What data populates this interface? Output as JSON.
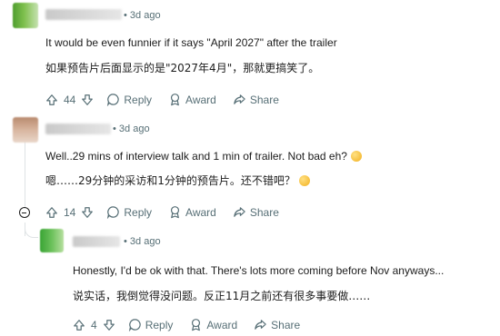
{
  "comments": [
    {
      "age": "3d ago",
      "text_en": "It would be even funnier if it says \"April 2027\" after the trailer",
      "text_zh": "如果预告片后面显示的是\"2027年4月\"，那就更搞笑了。",
      "votes": "44",
      "reply": "Reply",
      "award": "Award",
      "share": "Share"
    },
    {
      "age": "3d ago",
      "text_en": "Well..29 mins of interview talk and 1 min of trailer. Not bad eh?",
      "text_zh": "嗯……29分钟的采访和1分钟的预告片。还不错吧？",
      "emoji": "face-with-hand-over-mouth-emoji",
      "votes": "14",
      "reply": "Reply",
      "award": "Award",
      "share": "Share"
    },
    {
      "age": "3d ago",
      "text_en": "Honestly, I'd be ok with that. There's lots more coming before Nov anyways...",
      "text_zh": "说实话，我倒觉得没问题。反正11月之前还有很多事要做……",
      "votes": "4",
      "reply": "Reply",
      "award": "Award",
      "share": "Share"
    }
  ],
  "separator": "•",
  "colors": {
    "meta": "#576f76",
    "text": "#1c1c1c",
    "thread": "#dfe3e5"
  }
}
